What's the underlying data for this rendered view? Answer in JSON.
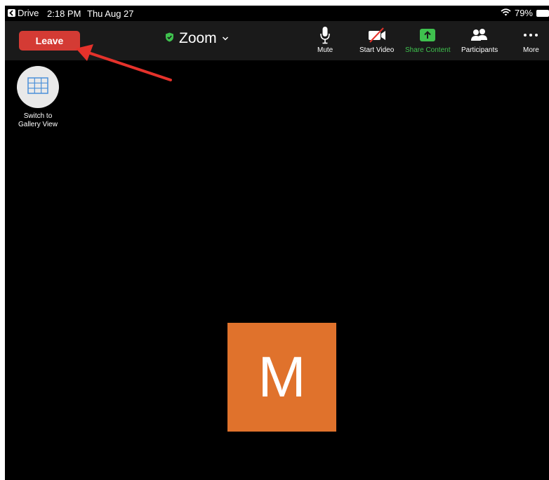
{
  "status_bar": {
    "back_app": "Drive",
    "time": "2:18 PM",
    "date": "Thu Aug 27",
    "battery": "79%"
  },
  "toolbar": {
    "leave_label": "Leave",
    "meeting_title": "Zoom",
    "tools": [
      {
        "label": "Mute",
        "icon": "microphone-icon"
      },
      {
        "label": "Start Video",
        "icon": "video-off-icon"
      },
      {
        "label": "Share Content",
        "icon": "share-screen-icon"
      },
      {
        "label": "Participants",
        "icon": "participants-icon"
      },
      {
        "label": "More",
        "icon": "more-dots-icon"
      }
    ]
  },
  "gallery": {
    "label_line1": "Switch to",
    "label_line2": "Gallery View"
  },
  "participant": {
    "initial": "M"
  },
  "colors": {
    "leave": "#d43b34",
    "share": "#3fc14e",
    "avatar": "#e0722c",
    "toolbar_bg": "#1a1a1a",
    "annotation_arrow": "#e5322b"
  }
}
